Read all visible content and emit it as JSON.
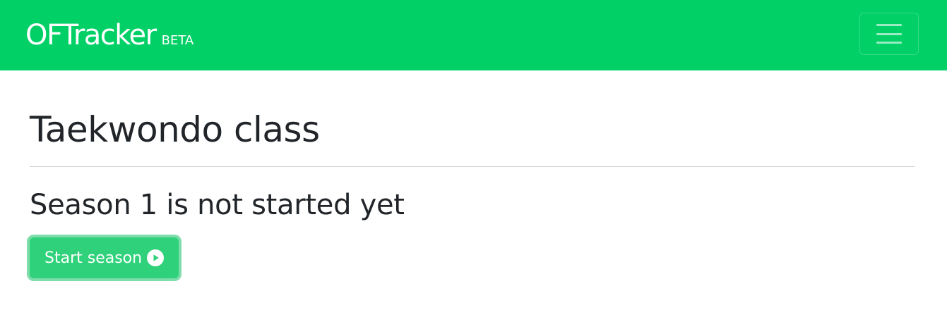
{
  "navbar": {
    "brand_name": "OFTracker",
    "brand_badge": "BETA",
    "toggler_icon": "hamburger-menu-icon",
    "background_color": "#00d066"
  },
  "main": {
    "title": "Taekwondo class",
    "season_heading": "Season 1 is not started yet",
    "start_button": {
      "label": "Start season",
      "icon": "play-circle-icon",
      "color": "#2fd27b"
    }
  }
}
